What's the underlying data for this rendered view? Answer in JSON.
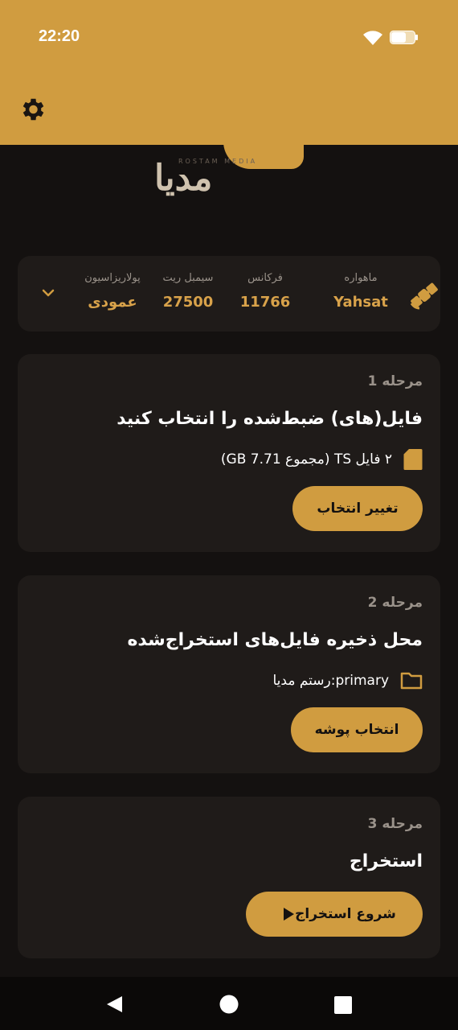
{
  "status_bar": {
    "time": "22:20"
  },
  "app_bar": {
    "settings_icon": "gear-icon"
  },
  "logo": {
    "subtitle": "ROSTAM MEDIA",
    "main_text": "مدیا"
  },
  "satellite": {
    "icon": "satellite-icon",
    "fields": [
      {
        "label": "ماهواره",
        "value": "Yahsat"
      },
      {
        "label": "فرکانس",
        "value": "11766"
      },
      {
        "label": "سیمبل ریت",
        "value": "27500"
      },
      {
        "label": "پولاریزاسیون",
        "value": "عمودی"
      }
    ],
    "expand_icon": "chevron-down-icon"
  },
  "steps": [
    {
      "label": "مرحله 1",
      "title": "فایل(های) ضبط‌شده را انتخاب کنید",
      "info_icon": "file-icon",
      "info": "۲ فایل TS (مجموع 7.71 GB)",
      "button": "تغییر انتخاب"
    },
    {
      "label": "مرحله 2",
      "title": "محل ذخیره فایل‌های استخراج‌شده",
      "info_icon": "folder-icon",
      "info": "primary:رستم مدیا",
      "button": "انتخاب پوشه"
    },
    {
      "label": "مرحله 3",
      "title": "استخراج",
      "button_icon": "play-icon",
      "button": "شروع استخراج"
    }
  ],
  "colors": {
    "accent": "#d09c40",
    "background": "#141110",
    "card": "#1f1b19",
    "muted": "#9a928a",
    "value": "#d8a24a"
  }
}
